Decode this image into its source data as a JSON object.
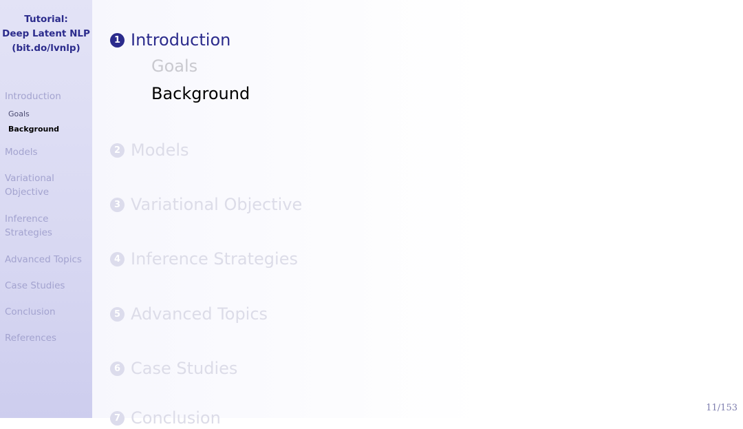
{
  "sidebar": {
    "title_lines": [
      "Tutorial:",
      "Deep Latent NLP",
      "(bit.do/lvnlp)"
    ],
    "nav": {
      "introduction": "Introduction",
      "goals": "Goals",
      "background": "Background",
      "models": "Models",
      "variational_1": "Variational",
      "variational_2": "Objective",
      "inference_1": "Inference",
      "inference_2": "Strategies",
      "advanced": "Advanced Topics",
      "case": "Case Studies",
      "conclusion": "Conclusion",
      "references": "References"
    }
  },
  "outline": {
    "sections": [
      {
        "num": "1",
        "label": "Introduction"
      },
      {
        "num": "2",
        "label": "Models"
      },
      {
        "num": "3",
        "label": "Variational Objective"
      },
      {
        "num": "4",
        "label": "Inference Strategies"
      },
      {
        "num": "5",
        "label": "Advanced Topics"
      },
      {
        "num": "6",
        "label": "Case Studies"
      },
      {
        "num": "7",
        "label": "Conclusion"
      }
    ],
    "subsections": [
      "Goals",
      "Background"
    ]
  },
  "page_number": "11/153",
  "colors": {
    "accent": "#2b2b8c",
    "sidebar_bg": "#d8d8f2",
    "dimmed_text": "#dcdce8"
  }
}
